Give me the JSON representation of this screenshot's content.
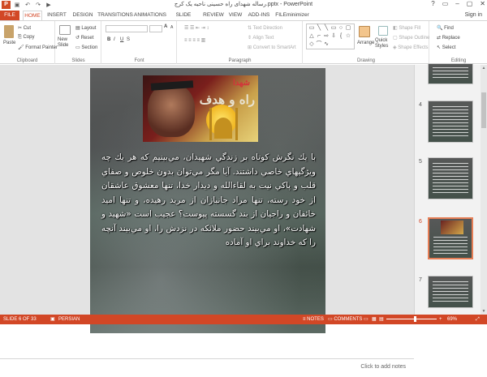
{
  "titlebar": {
    "title": "رساله شهدای راه حسینی ناحیه یک کرج.pptx - PowerPoint",
    "app_icon_label": "P",
    "quick_icons": [
      "save-icon",
      "undo-icon",
      "redo-icon",
      "start-icon"
    ],
    "controls": [
      "?",
      "▭",
      "–",
      "▢",
      "✕"
    ]
  },
  "tabs": {
    "file": "FILE",
    "items": [
      "HOME",
      "INSERT",
      "DESIGN",
      "TRANSITIONS",
      "ANIMATIONS",
      "SLIDE SHOW",
      "REVIEW",
      "VIEW",
      "ADD-INS",
      "FILEminimizer"
    ],
    "active": "HOME",
    "signin": "Sign in"
  },
  "ribbon": {
    "clipboard": {
      "label": "Clipboard",
      "paste": "Paste",
      "cut": "Cut",
      "copy": "Copy",
      "format_painter": "Format Painter"
    },
    "slides": {
      "label": "Slides",
      "new_slide": "New Slide",
      "layout": "Layout",
      "reset": "Reset",
      "section": "Section"
    },
    "font": {
      "label": "Font",
      "bold": "B",
      "italic": "I",
      "underline": "U",
      "strike": "S",
      "size_up": "A",
      "size_down": "A"
    },
    "paragraph": {
      "label": "Paragraph",
      "text_direction": "Text Direction",
      "align_text": "Align Text",
      "convert_smartart": "Convert to SmartArt"
    },
    "drawing": {
      "label": "Drawing",
      "arrange": "Arrange",
      "quick_styles": "Quick Styles",
      "shape_fill": "Shape Fill",
      "shape_outline": "Shape Outline",
      "shape_effects": "Shape Effects"
    },
    "editing": {
      "label": "Editing",
      "find": "Find",
      "replace": "Replace",
      "select": "Select"
    }
  },
  "slide": {
    "poster_title": "راه و هدف",
    "poster_subtitle": "شهدا",
    "body": "با يك نگرش كوتاه بر زندگي شهيدان، مي‌بينيم كه هر يك چه ويژگيهاي خاصي داشتند. آيا مگر مي‌توان بدون خلوص و صفاي قلب و پاكي نيت به لقاءالله و ديدار خدا، تنها معشوق عاشقان از خود رسته، تنها مراد جانبازان از مريد رهيده، و تنها اميد خائفان و راجيان از بند گسسته پيوست؟ عجيب است «شهيد و شهادت»، او مي‌بيند حضور ملائكه در نزدش را، او مي‌بيند آنچه را كه خداوند براي او آماده"
  },
  "notes": {
    "placeholder": "Click to add notes"
  },
  "thumbnails": {
    "items": [
      {
        "num": "",
        "selected": false
      },
      {
        "num": "4",
        "selected": false
      },
      {
        "num": "5",
        "selected": false
      },
      {
        "num": "6",
        "selected": true
      },
      {
        "num": "7",
        "selected": false
      }
    ]
  },
  "statusbar": {
    "slide_info": "SLIDE 6 OF 33",
    "language": "PERSIAN",
    "notes": "NOTES",
    "comments": "COMMENTS",
    "zoom": "69%"
  },
  "colors": {
    "accent": "#d24726",
    "selected_thumb": "#e67e56"
  }
}
